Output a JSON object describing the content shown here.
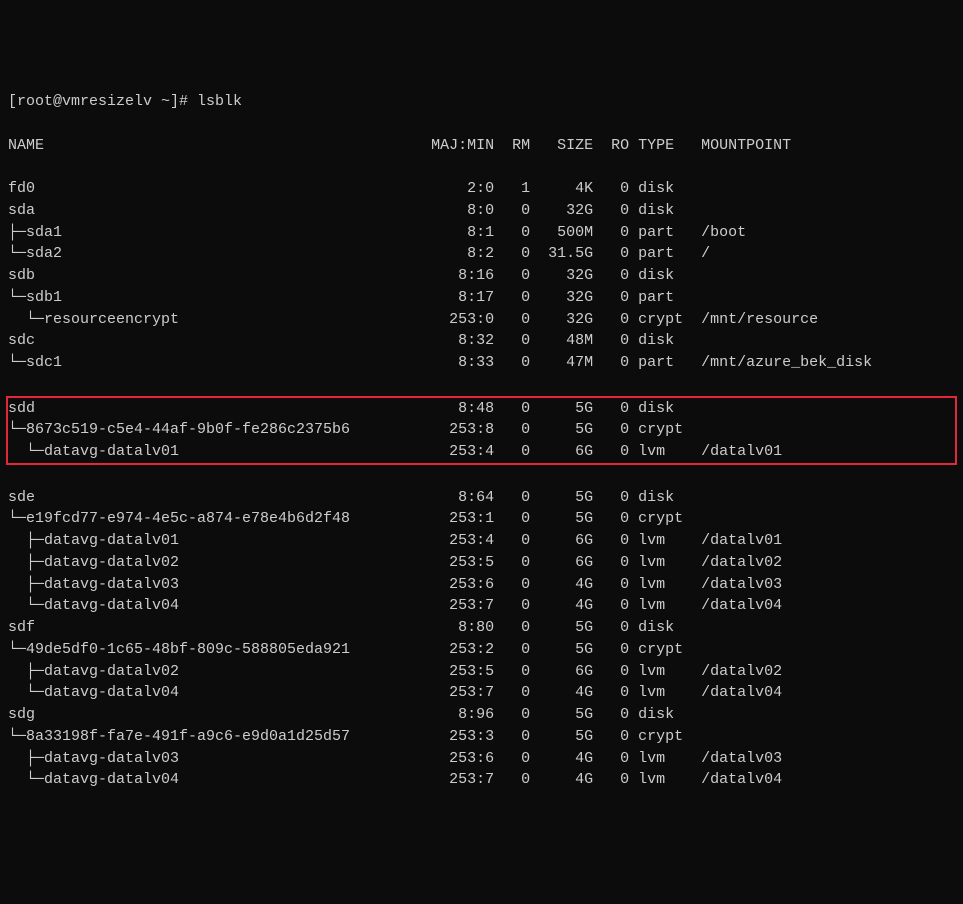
{
  "prompt": "[root@vmresizelv ~]# ",
  "command": "lsblk",
  "header": {
    "name": "NAME",
    "majmin": "MAJ:MIN",
    "rm": "RM",
    "size": "SIZE",
    "ro": "RO",
    "type": "TYPE",
    "mountpoint": "MOUNTPOINT"
  },
  "rows": [
    {
      "name": "fd0",
      "majmin": "2:0",
      "rm": "1",
      "size": "4K",
      "ro": "0",
      "type": "disk",
      "mount": ""
    },
    {
      "name": "sda",
      "majmin": "8:0",
      "rm": "0",
      "size": "32G",
      "ro": "0",
      "type": "disk",
      "mount": ""
    },
    {
      "name": "├─sda1",
      "majmin": "8:1",
      "rm": "0",
      "size": "500M",
      "ro": "0",
      "type": "part",
      "mount": "/boot"
    },
    {
      "name": "└─sda2",
      "majmin": "8:2",
      "rm": "0",
      "size": "31.5G",
      "ro": "0",
      "type": "part",
      "mount": "/"
    },
    {
      "name": "sdb",
      "majmin": "8:16",
      "rm": "0",
      "size": "32G",
      "ro": "0",
      "type": "disk",
      "mount": ""
    },
    {
      "name": "└─sdb1",
      "majmin": "8:17",
      "rm": "0",
      "size": "32G",
      "ro": "0",
      "type": "part",
      "mount": ""
    },
    {
      "name": "  └─resourceencrypt",
      "majmin": "253:0",
      "rm": "0",
      "size": "32G",
      "ro": "0",
      "type": "crypt",
      "mount": "/mnt/resource"
    },
    {
      "name": "sdc",
      "majmin": "8:32",
      "rm": "0",
      "size": "48M",
      "ro": "0",
      "type": "disk",
      "mount": ""
    },
    {
      "name": "└─sdc1",
      "majmin": "8:33",
      "rm": "0",
      "size": "47M",
      "ro": "0",
      "type": "part",
      "mount": "/mnt/azure_bek_disk"
    }
  ],
  "highlighted": [
    {
      "name": "sdd",
      "majmin": "8:48",
      "rm": "0",
      "size": "5G",
      "ro": "0",
      "type": "disk",
      "mount": ""
    },
    {
      "name": "└─8673c519-c5e4-44af-9b0f-fe286c2375b6",
      "majmin": "253:8",
      "rm": "0",
      "size": "5G",
      "ro": "0",
      "type": "crypt",
      "mount": ""
    },
    {
      "name": "  └─datavg-datalv01",
      "majmin": "253:4",
      "rm": "0",
      "size": "6G",
      "ro": "0",
      "type": "lvm",
      "mount": "/datalv01"
    }
  ],
  "rows2": [
    {
      "name": "sde",
      "majmin": "8:64",
      "rm": "0",
      "size": "5G",
      "ro": "0",
      "type": "disk",
      "mount": ""
    },
    {
      "name": "└─e19fcd77-e974-4e5c-a874-e78e4b6d2f48",
      "majmin": "253:1",
      "rm": "0",
      "size": "5G",
      "ro": "0",
      "type": "crypt",
      "mount": ""
    },
    {
      "name": "  ├─datavg-datalv01",
      "majmin": "253:4",
      "rm": "0",
      "size": "6G",
      "ro": "0",
      "type": "lvm",
      "mount": "/datalv01"
    },
    {
      "name": "  ├─datavg-datalv02",
      "majmin": "253:5",
      "rm": "0",
      "size": "6G",
      "ro": "0",
      "type": "lvm",
      "mount": "/datalv02"
    },
    {
      "name": "  ├─datavg-datalv03",
      "majmin": "253:6",
      "rm": "0",
      "size": "4G",
      "ro": "0",
      "type": "lvm",
      "mount": "/datalv03"
    },
    {
      "name": "  └─datavg-datalv04",
      "majmin": "253:7",
      "rm": "0",
      "size": "4G",
      "ro": "0",
      "type": "lvm",
      "mount": "/datalv04"
    },
    {
      "name": "sdf",
      "majmin": "8:80",
      "rm": "0",
      "size": "5G",
      "ro": "0",
      "type": "disk",
      "mount": ""
    },
    {
      "name": "└─49de5df0-1c65-48bf-809c-588805eda921",
      "majmin": "253:2",
      "rm": "0",
      "size": "5G",
      "ro": "0",
      "type": "crypt",
      "mount": ""
    },
    {
      "name": "  ├─datavg-datalv02",
      "majmin": "253:5",
      "rm": "0",
      "size": "6G",
      "ro": "0",
      "type": "lvm",
      "mount": "/datalv02"
    },
    {
      "name": "  └─datavg-datalv04",
      "majmin": "253:7",
      "rm": "0",
      "size": "4G",
      "ro": "0",
      "type": "lvm",
      "mount": "/datalv04"
    },
    {
      "name": "sdg",
      "majmin": "8:96",
      "rm": "0",
      "size": "5G",
      "ro": "0",
      "type": "disk",
      "mount": ""
    },
    {
      "name": "└─8a33198f-fa7e-491f-a9c6-e9d0a1d25d57",
      "majmin": "253:3",
      "rm": "0",
      "size": "5G",
      "ro": "0",
      "type": "crypt",
      "mount": ""
    },
    {
      "name": "  ├─datavg-datalv03",
      "majmin": "253:6",
      "rm": "0",
      "size": "4G",
      "ro": "0",
      "type": "lvm",
      "mount": "/datalv03"
    },
    {
      "name": "  └─datavg-datalv04",
      "majmin": "253:7",
      "rm": "0",
      "size": "4G",
      "ro": "0",
      "type": "lvm",
      "mount": "/datalv04"
    }
  ]
}
